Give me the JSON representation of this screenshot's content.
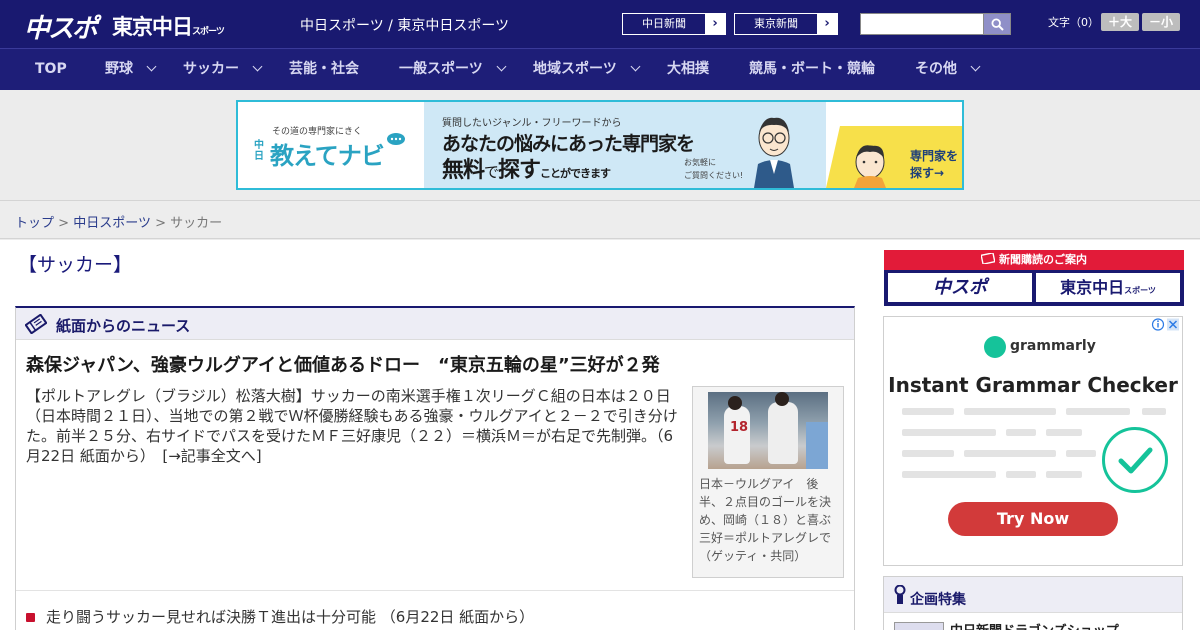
{
  "header": {
    "logo_chuspo": "中スポ",
    "logo_tokyo": "東京中日",
    "logo_tokyo_small": "スポーツ",
    "site_title": "中日スポーツ / 東京中日スポーツ",
    "paper_links": [
      {
        "label": "中日新聞",
        "arrow": "›"
      },
      {
        "label": "東京新聞",
        "arrow": "›"
      }
    ],
    "search": {
      "value": "",
      "placeholder": ""
    },
    "font_size_label": "文字（0）",
    "font_larger": "＋大",
    "font_smaller": "－小"
  },
  "nav": {
    "items": [
      {
        "label": "TOP",
        "has_dropdown": false
      },
      {
        "label": "野球",
        "has_dropdown": true
      },
      {
        "label": "サッカー",
        "has_dropdown": true
      },
      {
        "label": "芸能・社会",
        "has_dropdown": false
      },
      {
        "label": "一般スポーツ",
        "has_dropdown": true
      },
      {
        "label": "地域スポーツ",
        "has_dropdown": true
      },
      {
        "label": "大相撲",
        "has_dropdown": false
      },
      {
        "label": "競馬・ボート・競輪",
        "has_dropdown": false
      },
      {
        "label": "その他",
        "has_dropdown": true
      }
    ]
  },
  "banner": {
    "sub": "その道の専門家にきく",
    "logo_tag": "中日",
    "logo": "教えてナビ",
    "question": "質問したいジャンル・フリーワードから",
    "main1": "あなたの悩みにあった専門家を",
    "main2_a": "無料",
    "main2_b": "で",
    "main2_c": "探す",
    "main2_d": "ことができます",
    "note1": "お気軽に",
    "note2": "ご質問ください!",
    "cta1": "専門家を",
    "cta2": "探す→",
    "accent": "#2fbcd8"
  },
  "breadcrumb": {
    "items": [
      "トップ",
      "中日スポーツ"
    ],
    "separator": ">",
    "current": "サッカー"
  },
  "main": {
    "page_title": "【サッカー】",
    "news": {
      "section_title": "紙面からのニュース",
      "headline": "森保ジャパン、強豪ウルグアイと価値あるドロー　“東京五輪の星”三好が２発",
      "body": "【ポルトアレグレ（ブラジル）松落大樹】サッカーの南米選手権１次リーグＣ組の日本は２０日（日本時間２１日）、当地での第２戦でＷ杯優勝経験もある強豪・ウルグアイと２－２で引き分けた。前半２５分、右サイドでパスを受けたＭＦ三好康児（２２）＝横浜Ｍ＝が右足で先制弾。（6月22日 紙面から）　[→記事全文へ]",
      "photo_jersey": "18",
      "photo_caption": "日本－ウルグアイ　後半、２点目のゴールを決め、岡崎（１８）と喜ぶ三好＝ポルトアレグレで（ゲッティ・共同）",
      "link": "走り闘うサッカー見せれば決勝Ｔ進出は十分可能 （6月22日 紙面から）"
    }
  },
  "sidebar": {
    "subscribe": {
      "title": "新聞購読のご案内",
      "logo_chuspo": "中スポ",
      "logo_tokyo": "東京中日",
      "logo_tokyo_small": "スポーツ"
    },
    "ad": {
      "brand": "grammarly",
      "title": "Instant Grammar Checker",
      "cta": "Try Now",
      "brand_color": "#15c39a",
      "cta_color": "#d23a3a"
    },
    "feature": {
      "title": "企画特集",
      "item": "中日新聞ドラゴンズショップ"
    }
  },
  "colors": {
    "header_bg": "#191970",
    "accent_red": "#c8102e",
    "link": "#2a3c8c"
  },
  "icons": [
    "search-icon",
    "chevron-right-icon",
    "chevron-down-icon",
    "ticket-icon",
    "bullet-icon",
    "checkmark-icon",
    "adchoices-icon",
    "close-icon",
    "pin-icon"
  ]
}
